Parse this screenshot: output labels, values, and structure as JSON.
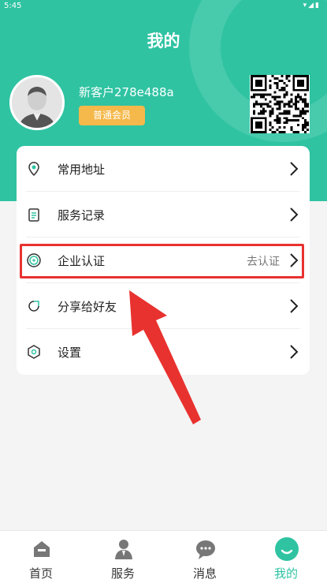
{
  "status_bar": {
    "time": "5:45",
    "icons": "▾◢▮"
  },
  "page_title": "我的",
  "profile": {
    "username": "新客户278e488a",
    "member_level": "普通会员"
  },
  "menu": [
    {
      "label": "常用地址",
      "icon": "location-icon",
      "value": ""
    },
    {
      "label": "服务记录",
      "icon": "clipboard-icon",
      "value": ""
    },
    {
      "label": "企业认证",
      "icon": "enterprise-icon",
      "value": "去认证"
    },
    {
      "label": "分享给好友",
      "icon": "share-icon",
      "value": ""
    },
    {
      "label": "设置",
      "icon": "settings-icon",
      "value": ""
    }
  ],
  "tabbar": [
    {
      "label": "首页",
      "icon": "home-icon",
      "active": false
    },
    {
      "label": "服务",
      "icon": "service-icon",
      "active": false
    },
    {
      "label": "消息",
      "icon": "message-icon",
      "active": false
    },
    {
      "label": "我的",
      "icon": "profile-icon",
      "active": true
    }
  ],
  "colors": {
    "primary": "#2fc3a2",
    "badge": "#f5b84a",
    "annotation": "#e8322f",
    "background": "#f4f4f4"
  }
}
